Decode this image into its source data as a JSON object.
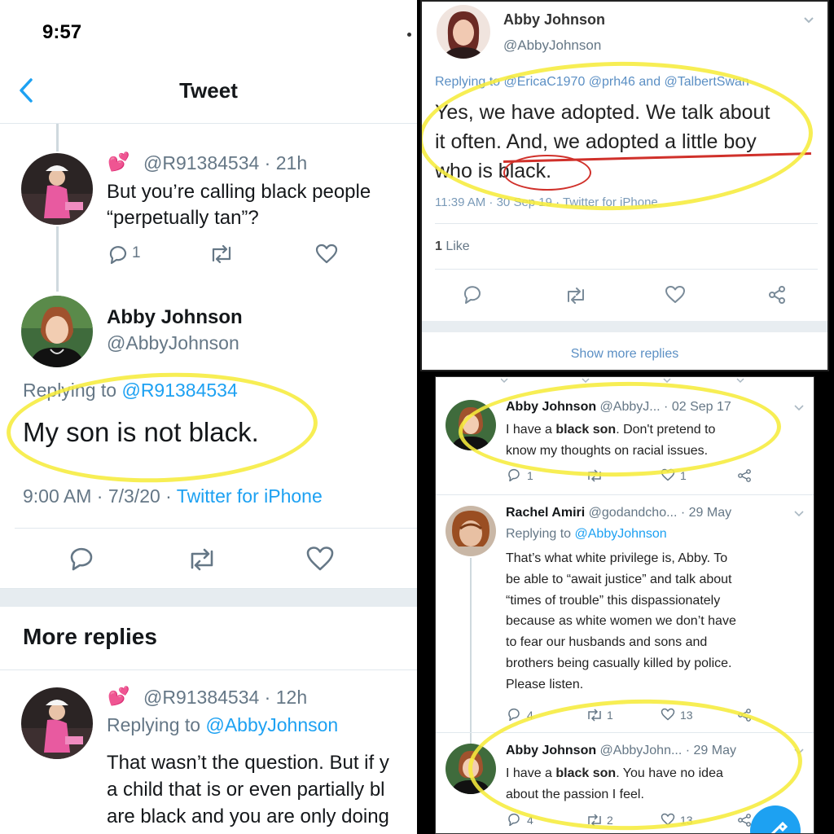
{
  "left": {
    "status_time": "9:57",
    "header_title": "Tweet",
    "tweet1": {
      "emoji": "💕",
      "handle_time": "@R91384534 · 21h",
      "text_line1": "But you’re calling black people",
      "text_line2": "“perpetually tan”?",
      "reply_count": "1"
    },
    "main": {
      "name": "Abby Johnson",
      "handle": "@AbbyJohnson",
      "replying_prefix": "Replying to ",
      "replying_to": "@R91384534",
      "text": "My son is not black.",
      "timestamp": "9:00 AM · 7/3/20 · ",
      "source": "Twitter for iPhone"
    },
    "more_replies_heading": "More replies",
    "tweet2": {
      "emoji": "💕",
      "handle_time": "@R91384534 · 12h",
      "replying_prefix": "Replying to ",
      "replying_to": "@AbbyJohnson",
      "line1": "That wasn’t the question. But if y",
      "line2": "a child that is or even partially bl",
      "line3": "are black and you are only doing"
    }
  },
  "top_right": {
    "name": "Abby Johnson",
    "handle": "@AbbyJohnson",
    "replying": "Replying to @EricaC1970 @prh46 and @TalbertSwan",
    "line1": "Yes, we have adopted. We talk about",
    "line2": "it often. And, we adopted a little boy",
    "line3": "who is black.",
    "timestamp": "11:39 AM · 30 Sep 19 · Twitter for iPhone",
    "likes_number": "1",
    "likes_label": " Like",
    "show_more": "Show more replies"
  },
  "bottom_right": {
    "t1": {
      "name": "Abby Johnson",
      "handle_date": " @AbbyJ... · 02 Sep 17",
      "line1_pre": "I have a ",
      "line1_bold": "black son",
      "line1_post": ". Don't pretend to",
      "line2": "know my thoughts on racial issues.",
      "replies": "1",
      "likes": "1"
    },
    "t2": {
      "name": "Rachel Amiri",
      "handle_date": " @godandcho... · 29 May",
      "replying_prefix": "Replying to ",
      "replying_to": "@AbbyJohnson",
      "lines": [
        "That’s what white privilege is, Abby. To",
        "be able to “await justice” and talk about",
        "“times of trouble” this dispassionately",
        "because as white women we don’t have",
        "to fear our husbands and sons and",
        "brothers being casually killed by police.",
        "Please listen."
      ],
      "replies": "4",
      "retweets": "1",
      "likes": "13"
    },
    "t3": {
      "name": "Abby Johnson",
      "handle_date": " @AbbyJohn... · 29 May",
      "line1_pre": "I have a ",
      "line1_bold": "black son",
      "line1_post": ". You have no idea",
      "line2": "about the passion I feel.",
      "replies": "4",
      "retweets": "2",
      "likes": "13"
    }
  },
  "colors": {
    "twitter_blue": "#1da1f2",
    "grey_text": "#657786",
    "highlight_yellow": "#f6ec3c"
  }
}
